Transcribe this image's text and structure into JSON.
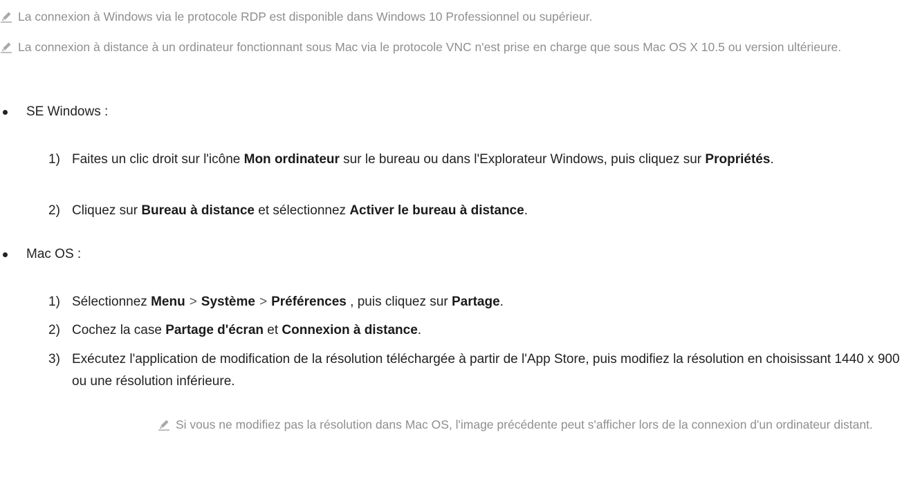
{
  "notes": {
    "rdp": "La connexion à Windows via le protocole RDP est disponible dans Windows 10 Professionnel ou supérieur.",
    "vnc": "La connexion à distance à un ordinateur fonctionnant sous Mac via le protocole VNC n'est prise en charge que sous Mac OS X 10.5 ou version ultérieure.",
    "resolution": "Si vous ne modifiez pas la résolution dans Mac OS, l'image précédente peut s'afficher lors de la connexion d'un ordinateur distant."
  },
  "windows": {
    "heading": "SE Windows :",
    "step1": {
      "num": "1)",
      "a": "Faites un clic droit sur l'icône ",
      "b": "Mon ordinateur",
      "c": " sur le bureau ou dans l'Explorateur Windows, puis cliquez sur ",
      "d": "Propriétés",
      "e": "."
    },
    "step2": {
      "num": "2)",
      "a": "Cliquez sur ",
      "b": "Bureau à distance",
      "c": " et sélectionnez ",
      "d": "Activer le bureau à distance",
      "e": "."
    }
  },
  "mac": {
    "heading": "Mac OS :",
    "step1": {
      "num": "1)",
      "a": "Sélectionnez ",
      "menu": "Menu",
      "sep": ">",
      "system": "Système",
      "prefs": "Préférences",
      "c": " , puis cliquez sur ",
      "d": "Partage",
      "e": "."
    },
    "step2": {
      "num": "2)",
      "a": "Cochez la case ",
      "b": "Partage d'écran",
      "c": " et ",
      "d": "Connexion à distance",
      "e": "."
    },
    "step3": {
      "num": "3)",
      "text": "Exécutez l'application de modification de la résolution téléchargée à partir de l'App Store, puis modifiez la résolution en choisissant 1440 x 900 ou une résolution inférieure."
    }
  },
  "icons": {
    "note": "pencil-icon",
    "bullet": "bullet-dot-icon"
  }
}
